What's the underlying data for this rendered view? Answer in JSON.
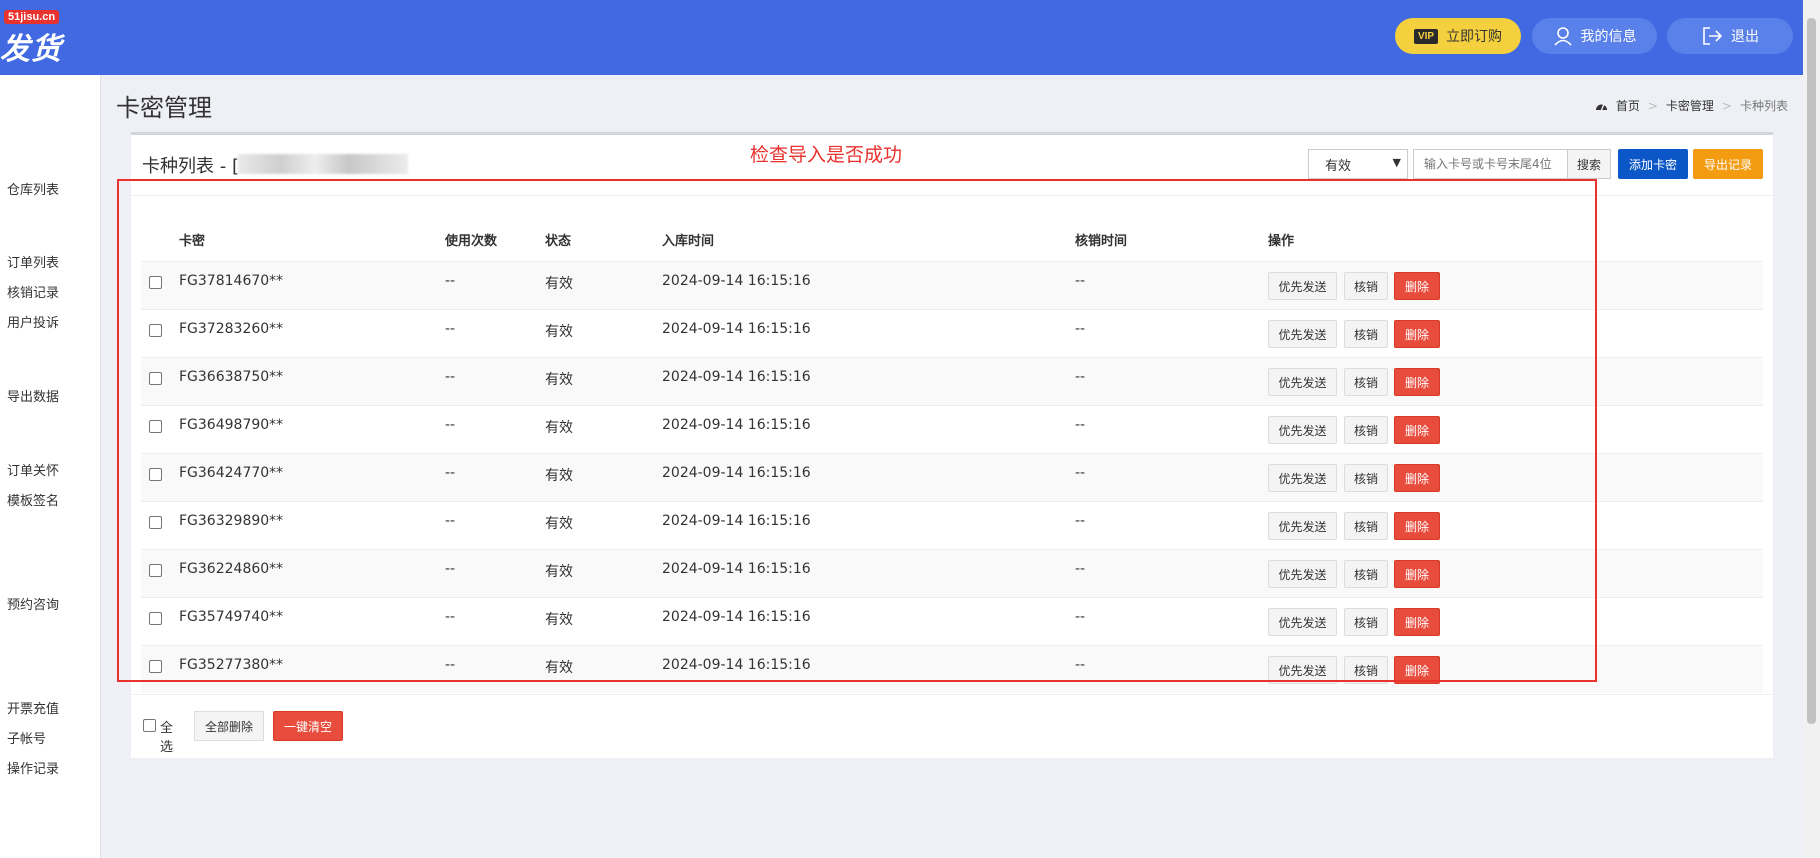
{
  "header": {
    "logo_badge": "51jisu.cn",
    "logo_text": "发货",
    "vip_icon": "VIP",
    "buy_label": "立即订购",
    "info_label": "我的信息",
    "logout_label": "退出",
    "colors": {
      "bar": "#4169e1",
      "vip": "#f4d03f"
    }
  },
  "sidebar": {
    "items": [
      {
        "label": "仓库列表"
      },
      {
        "label": "订单列表"
      },
      {
        "label": "核销记录"
      },
      {
        "label": "用户投诉"
      },
      {
        "label": "导出数据"
      },
      {
        "label": "订单关怀"
      },
      {
        "label": "模板签名"
      },
      {
        "label": "预约咨询"
      },
      {
        "label": "开票充值"
      },
      {
        "label": "子帐号"
      },
      {
        "label": "操作记录"
      }
    ]
  },
  "page": {
    "title": "卡密管理",
    "breadcrumb": [
      "首页",
      "卡密管理",
      "卡种列表"
    ]
  },
  "panel": {
    "title": "卡种列表 - [",
    "annotation": "检查导入是否成功",
    "filter_value": "有效",
    "search_placeholder": "输入卡号或卡号末尾4位",
    "search_label": "搜索",
    "add_label": "添加卡密",
    "export_label": "导出记录"
  },
  "table": {
    "headers": {
      "card": "卡密",
      "used": "使用次数",
      "status": "状态",
      "time": "入库时间",
      "verify": "核销时间",
      "ops": "操作"
    },
    "op_labels": {
      "priority": "优先发送",
      "verify": "核销",
      "delete": "删除"
    },
    "rows": [
      {
        "card": "FG37814670**",
        "used": "--",
        "status": "有效",
        "time": "2024-09-14 16:15:16",
        "verify": "--"
      },
      {
        "card": "FG37283260**",
        "used": "--",
        "status": "有效",
        "time": "2024-09-14 16:15:16",
        "verify": "--"
      },
      {
        "card": "FG36638750**",
        "used": "--",
        "status": "有效",
        "time": "2024-09-14 16:15:16",
        "verify": "--"
      },
      {
        "card": "FG36498790**",
        "used": "--",
        "status": "有效",
        "time": "2024-09-14 16:15:16",
        "verify": "--"
      },
      {
        "card": "FG36424770**",
        "used": "--",
        "status": "有效",
        "time": "2024-09-14 16:15:16",
        "verify": "--"
      },
      {
        "card": "FG36329890**",
        "used": "--",
        "status": "有效",
        "time": "2024-09-14 16:15:16",
        "verify": "--"
      },
      {
        "card": "FG36224860**",
        "used": "--",
        "status": "有效",
        "time": "2024-09-14 16:15:16",
        "verify": "--"
      },
      {
        "card": "FG35749740**",
        "used": "--",
        "status": "有效",
        "time": "2024-09-14 16:15:16",
        "verify": "--"
      },
      {
        "card": "FG35277380**",
        "used": "--",
        "status": "有效",
        "time": "2024-09-14 16:15:16",
        "verify": "--"
      }
    ]
  },
  "footer": {
    "select_all": "全选",
    "delete_all": "全部删除",
    "clear_all": "一键清空"
  }
}
